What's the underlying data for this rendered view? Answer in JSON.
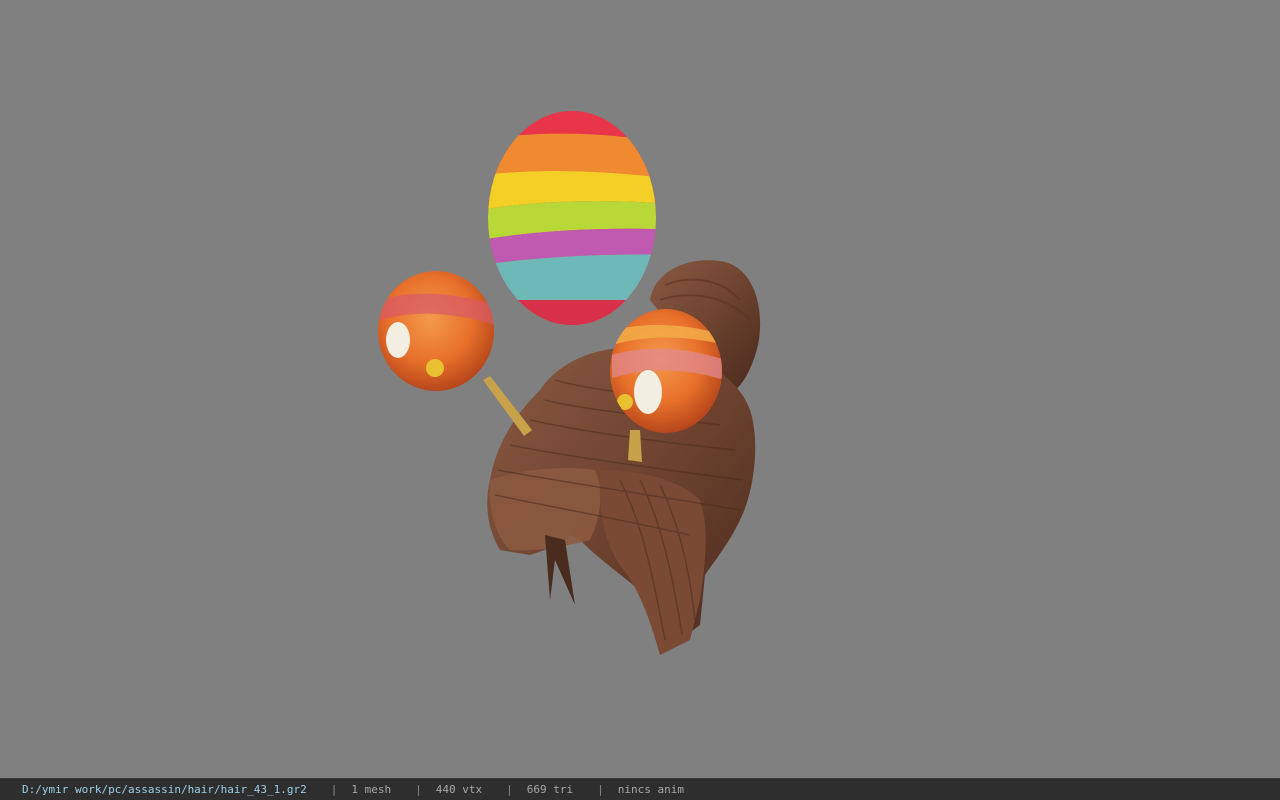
{
  "viewer": {
    "background_color": "#808080"
  },
  "model": {
    "description_icon": "hair-model-with-easter-eggs"
  },
  "status": {
    "file_path": "D:/ymir work/pc/assassin/hair/hair_43_1.gr2",
    "separator": "|",
    "mesh_count": "1 mesh",
    "vertex_count": "440 vtx",
    "triangle_count": "669 tri",
    "anim_info": "nincs anim"
  }
}
